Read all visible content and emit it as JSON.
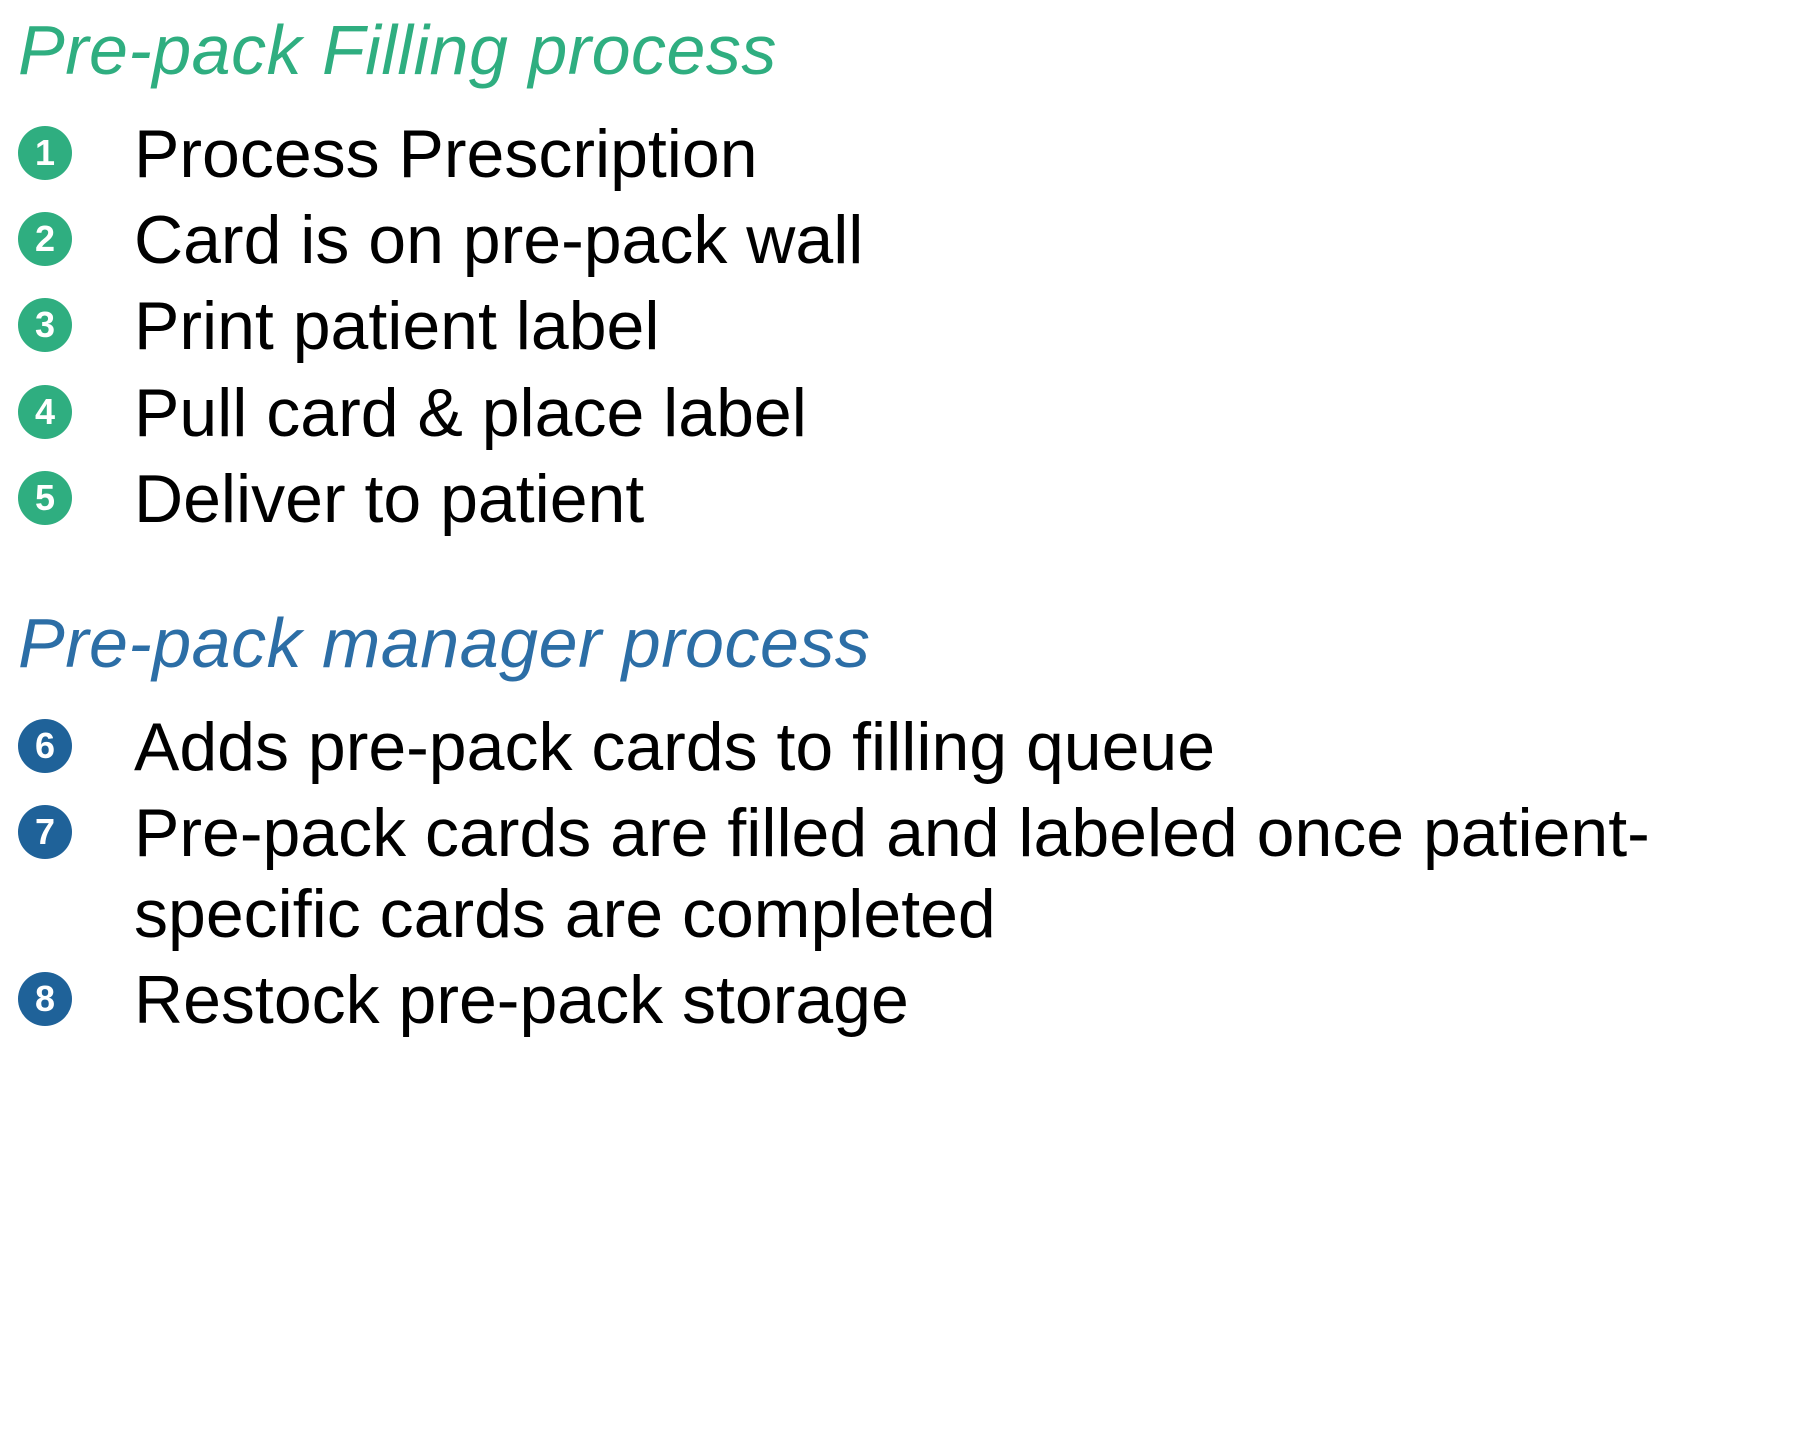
{
  "sections": [
    {
      "title": "Pre-pack Filling process",
      "color": "green",
      "items": [
        {
          "num": "1",
          "text": "Process Prescription"
        },
        {
          "num": "2",
          "text": "Card is on pre-pack wall"
        },
        {
          "num": "3",
          "text": "Print patient label"
        },
        {
          "num": "4",
          "text": "Pull card & place label"
        },
        {
          "num": "5",
          "text": "Deliver to patient"
        }
      ]
    },
    {
      "title": "Pre-pack manager process",
      "color": "blue",
      "items": [
        {
          "num": "6",
          "text": "Adds pre-pack cards to filling queue"
        },
        {
          "num": "7",
          "text": "Pre-pack cards are filled and labeled once patient-specific cards are completed"
        },
        {
          "num": "8",
          "text": "Restock pre-pack storage"
        }
      ]
    }
  ]
}
